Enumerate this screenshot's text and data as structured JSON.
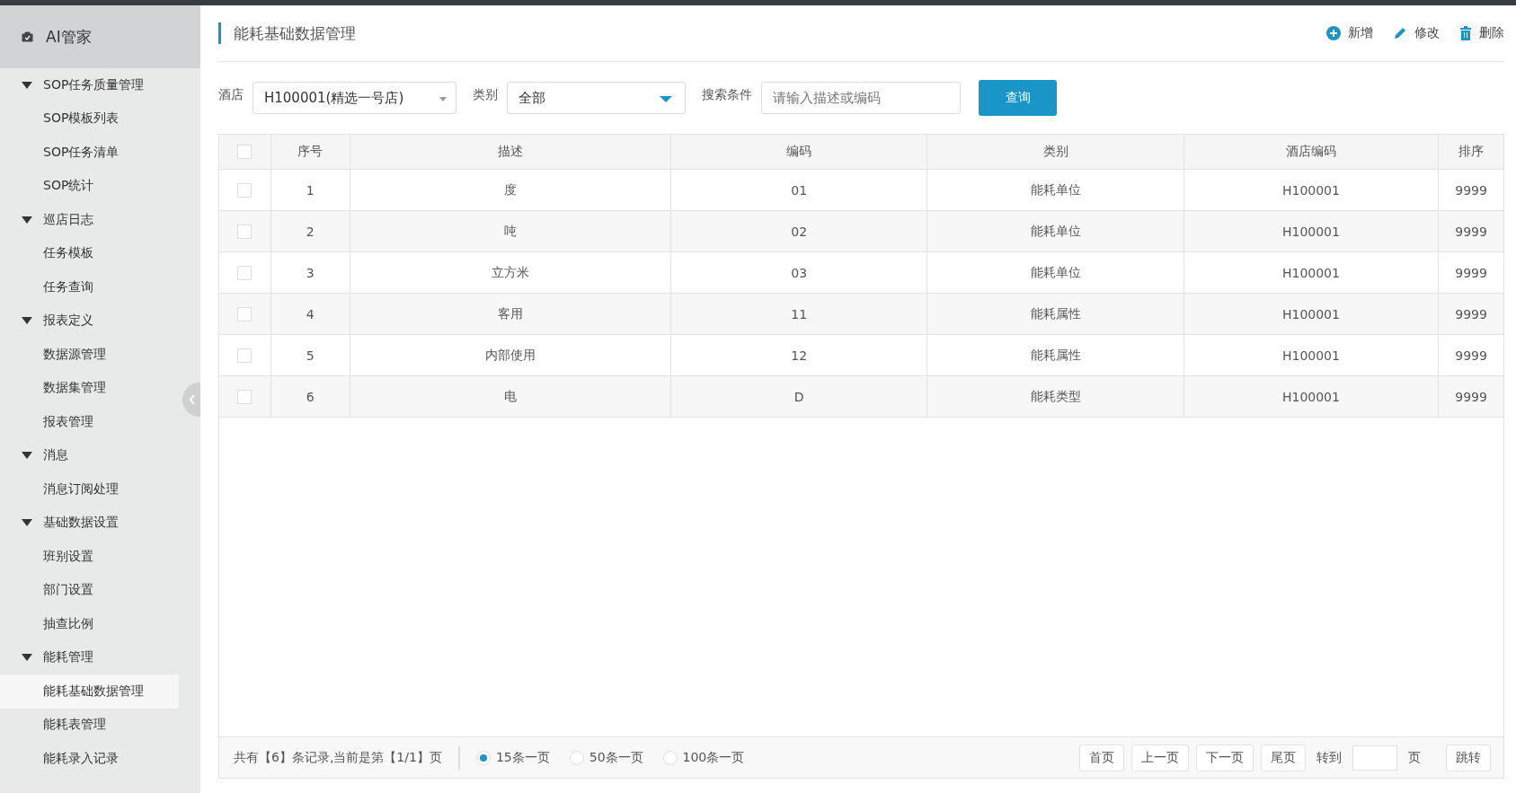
{
  "sidebar": {
    "title": "AI管家",
    "groups": [
      {
        "label": "SOP任务质量管理",
        "expanded": true,
        "children": [
          {
            "label": "SOP模板列表",
            "selected": false
          },
          {
            "label": "SOP任务清单",
            "selected": false
          },
          {
            "label": "SOP统计",
            "selected": false
          }
        ]
      },
      {
        "label": "巡店日志",
        "expanded": true,
        "children": [
          {
            "label": "任务模板",
            "selected": false
          },
          {
            "label": "任务查询",
            "selected": false
          }
        ]
      },
      {
        "label": "报表定义",
        "expanded": true,
        "children": [
          {
            "label": "数据源管理",
            "selected": false
          },
          {
            "label": "数据集管理",
            "selected": false
          },
          {
            "label": "报表管理",
            "selected": false
          }
        ]
      },
      {
        "label": "消息",
        "expanded": true,
        "children": [
          {
            "label": "消息订阅处理",
            "selected": false
          }
        ]
      },
      {
        "label": "基础数据设置",
        "expanded": true,
        "children": [
          {
            "label": "班别设置",
            "selected": false
          },
          {
            "label": "部门设置",
            "selected": false
          },
          {
            "label": "抽查比例",
            "selected": false
          }
        ]
      },
      {
        "label": "能耗管理",
        "expanded": true,
        "children": [
          {
            "label": "能耗基础数据管理",
            "selected": true
          },
          {
            "label": "能耗表管理",
            "selected": false
          },
          {
            "label": "能耗录入记录",
            "selected": false
          }
        ]
      }
    ]
  },
  "page_title": "能耗基础数据管理",
  "actions": [
    {
      "kind": "add",
      "label": "新增"
    },
    {
      "kind": "edit",
      "label": "修改"
    },
    {
      "kind": "delete",
      "label": "删除"
    }
  ],
  "filters": {
    "hotel_label": "酒店",
    "hotel_value": "H100001(精选一号店)",
    "category_label": "类别",
    "category_value": "全部",
    "search_label": "搜索条件",
    "search_placeholder": "请输入描述或编码",
    "query_button": "查询"
  },
  "table": {
    "columns": [
      "序号",
      "描述",
      "编码",
      "类别",
      "酒店编码",
      "排序"
    ],
    "header_checked": false,
    "rows": [
      {
        "checked": false,
        "cells": [
          "1",
          "度",
          "01",
          "能耗单位",
          "H100001",
          "9999"
        ]
      },
      {
        "checked": false,
        "cells": [
          "2",
          "吨",
          "02",
          "能耗单位",
          "H100001",
          "9999"
        ]
      },
      {
        "checked": false,
        "cells": [
          "3",
          "立方米",
          "03",
          "能耗单位",
          "H100001",
          "9999"
        ]
      },
      {
        "checked": false,
        "cells": [
          "4",
          "客用",
          "11",
          "能耗属性",
          "H100001",
          "9999"
        ]
      },
      {
        "checked": false,
        "cells": [
          "5",
          "内部使用",
          "12",
          "能耗属性",
          "H100001",
          "9999"
        ]
      },
      {
        "checked": false,
        "cells": [
          "6",
          "电",
          "D",
          "能耗类型",
          "H100001",
          "9999"
        ]
      }
    ]
  },
  "pagination": {
    "summary": "共有【6】条记录,当前是第【1/1】页",
    "page_sizes": [
      {
        "label": "15条一页",
        "selected": true
      },
      {
        "label": "50条一页",
        "selected": false
      },
      {
        "label": "100条一页",
        "selected": false
      }
    ],
    "buttons": [
      "首页",
      "上一页",
      "下一页",
      "尾页"
    ],
    "goto_label": "转到",
    "page_unit": "页",
    "jump_button": "跳转"
  }
}
